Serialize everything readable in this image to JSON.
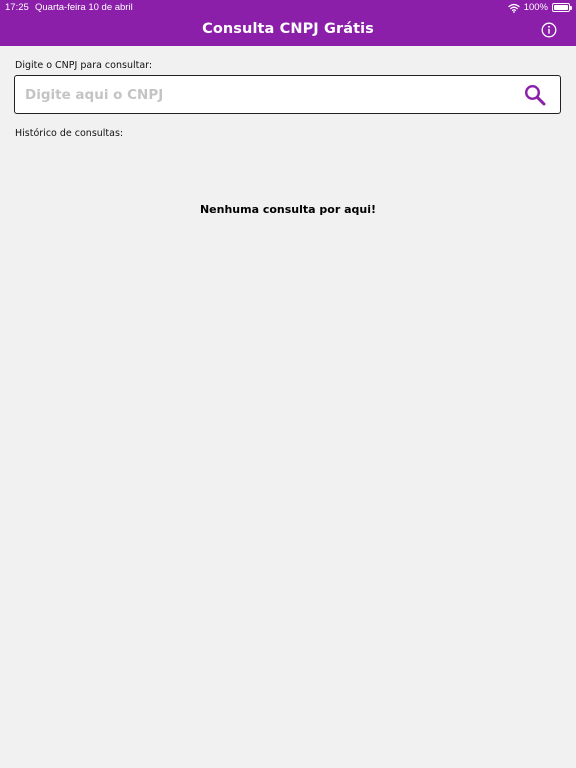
{
  "status_bar": {
    "time": "17:25",
    "date": "Quarta-feira 10 de abril",
    "battery_text": "100%",
    "battery_level": 1.0
  },
  "nav": {
    "title": "Consulta CNPJ Grátis",
    "info_icon": "info-circle-icon"
  },
  "search": {
    "label": "Digite o CNPJ para consultar:",
    "placeholder": "Digite aqui o CNPJ",
    "value": "",
    "button_icon": "search-icon"
  },
  "history": {
    "label": "Histórico de consultas:",
    "empty_message": "Nenhuma consulta por aqui!",
    "items": []
  },
  "colors": {
    "accent": "#8b1fa9",
    "background": "#f1f1f1",
    "search_icon": "#8b1fa9"
  }
}
